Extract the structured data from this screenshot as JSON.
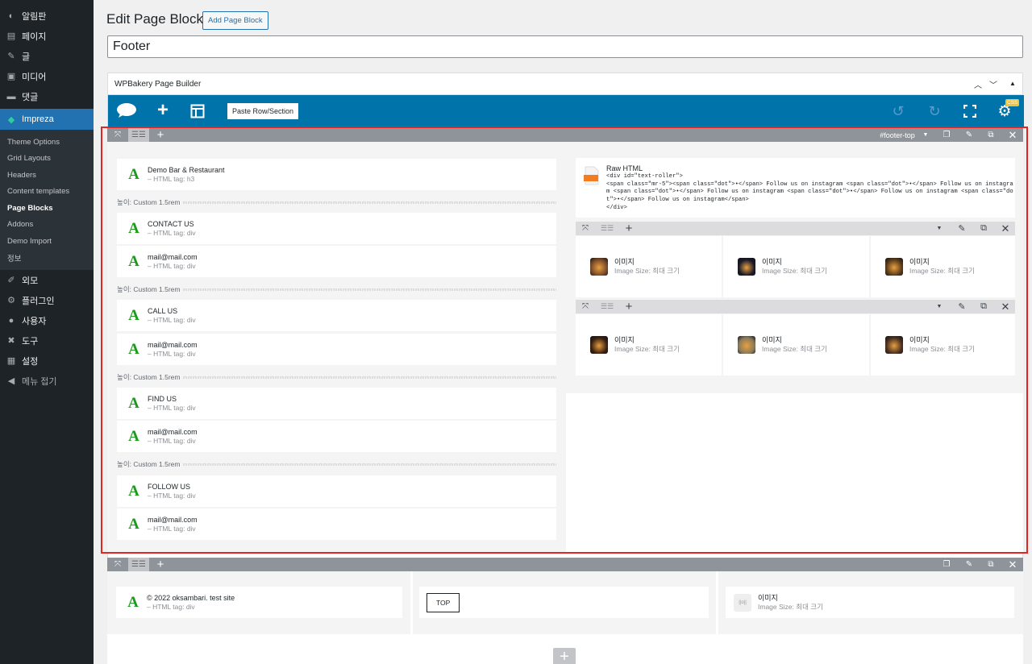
{
  "sidebar": {
    "items_top": [
      {
        "icon": "dashboard-icon",
        "label": "알림판"
      },
      {
        "icon": "pages-icon",
        "label": "페이지"
      },
      {
        "icon": "pin-icon",
        "label": "글"
      },
      {
        "icon": "media-icon",
        "label": "미디어"
      },
      {
        "icon": "comments-icon",
        "label": "댓글"
      }
    ],
    "active": {
      "icon": "impreza-icon",
      "label": "Impreza"
    },
    "submenu": [
      "Theme Options",
      "Grid Layouts",
      "Headers",
      "Content templates",
      "Page Blocks",
      "Addons",
      "Demo Import",
      "정보"
    ],
    "items_bottom": [
      {
        "icon": "appearance-icon",
        "label": "외모"
      },
      {
        "icon": "plugins-icon",
        "label": "플러그인"
      },
      {
        "icon": "users-icon",
        "label": "사용자"
      },
      {
        "icon": "tools-icon",
        "label": "도구"
      },
      {
        "icon": "settings-icon",
        "label": "설정"
      },
      {
        "icon": "collapse-icon",
        "label": "메뉴 접기"
      }
    ]
  },
  "header": {
    "title": "Edit Page Block",
    "add_button": "Add Page Block"
  },
  "title_value": "Footer",
  "builder": {
    "name": "WPBakery Page Builder",
    "paste_button": "Paste Row/Section",
    "css_badge": "CSS"
  },
  "row1": {
    "row_id": "#footer-top",
    "left_column": {
      "groups": [
        [
          {
            "t1": "Demo Bar & Restaurant",
            "t2": "– HTML tag: h3"
          }
        ],
        [
          {
            "t1": "CONTACT US",
            "t2": "– HTML tag: div"
          },
          {
            "t1": "mail@mail.com",
            "t2": "– HTML tag: div"
          }
        ],
        [
          {
            "t1": "CALL US",
            "t2": "– HTML tag: div"
          },
          {
            "t1": "mail@mail.com",
            "t2": "– HTML tag: div"
          }
        ],
        [
          {
            "t1": "FIND US",
            "t2": "– HTML tag: div"
          },
          {
            "t1": "mail@mail.com",
            "t2": "– HTML tag: div"
          }
        ],
        [
          {
            "t1": "FOLLOW US",
            "t2": "– HTML tag: div"
          },
          {
            "t1": "mail@mail.com",
            "t2": "– HTML tag: div"
          }
        ]
      ],
      "separator_label": "높이: Custom",
      "separator_value": "1.5rem"
    },
    "raw_html": {
      "title": "Raw HTML",
      "code": "<div id=\"text-roller\">\n<span class=\"mr-5\"><span class=\"dot\">•</span> Follow us on instagram <span class=\"dot\">•</span> Follow us on instagram <span class=\"dot\">•</span> Follow us on instagram <span class=\"dot\">•</span> Follow us on instagram <span class=\"dot\">•</span> Follow us on instagram</span>\n</div>"
    },
    "images": [
      {
        "t1": "이미지",
        "t2": "Image Size: 최대 크기",
        "color": "#7a4a2a"
      },
      {
        "t1": "이미지",
        "t2": "Image Size: 최대 크기",
        "color": "#1a1a2a"
      },
      {
        "t1": "이미지",
        "t2": "Image Size: 최대 크기",
        "color": "#5a3a1a"
      },
      {
        "t1": "이미지",
        "t2": "Image Size: 최대 크기",
        "color": "#3a2010"
      },
      {
        "t1": "이미지",
        "t2": "Image Size: 최대 크기",
        "color": "#8a7a5a"
      },
      {
        "t1": "이미지",
        "t2": "Image Size: 최대 크기",
        "color": "#4a3020"
      }
    ]
  },
  "row2": {
    "copyright": {
      "t1": "© 2022 oksambari. test site",
      "t2": "– HTML tag: div"
    },
    "top_button": "TOP",
    "image": {
      "t1": "이미지",
      "t2": "Image Size: 최대 크기"
    }
  },
  "colors": {
    "wp_blue": "#2271b1",
    "wpb_toolbar": "#0073aa",
    "highlight": "#e52424",
    "text_icon_green": "#1b9b1b"
  }
}
